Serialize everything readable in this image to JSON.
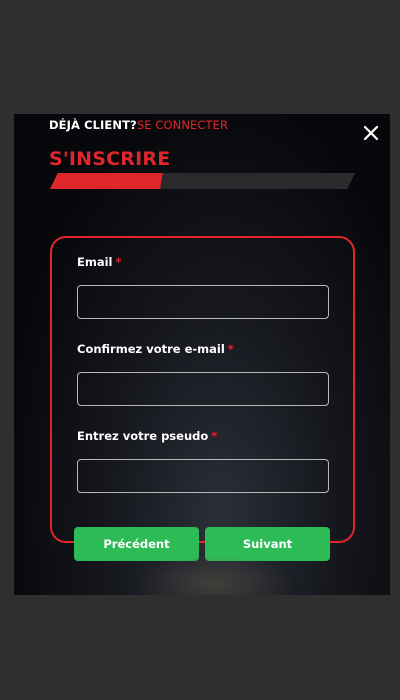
{
  "header": {
    "question": "DÉJÀ CLIENT?",
    "login_link": "SE CONNECTER",
    "close_icon": "close-icon"
  },
  "title": "S'INSCRIRE",
  "progress": {
    "fraction": 0.37
  },
  "form": {
    "fields": [
      {
        "label": "Email",
        "required_mark": "*",
        "value": ""
      },
      {
        "label": "Confirmez votre e-mail",
        "required_mark": "*",
        "value": ""
      },
      {
        "label": "Entrez votre pseudo",
        "required_mark": "*",
        "value": ""
      }
    ]
  },
  "buttons": {
    "previous": "Précédent",
    "next": "Suivant"
  },
  "colors": {
    "accent_red": "#e0262b",
    "button_green": "#2dbb55",
    "page_bg": "#2f2f2f",
    "progress_track": "#2b2b2e"
  }
}
